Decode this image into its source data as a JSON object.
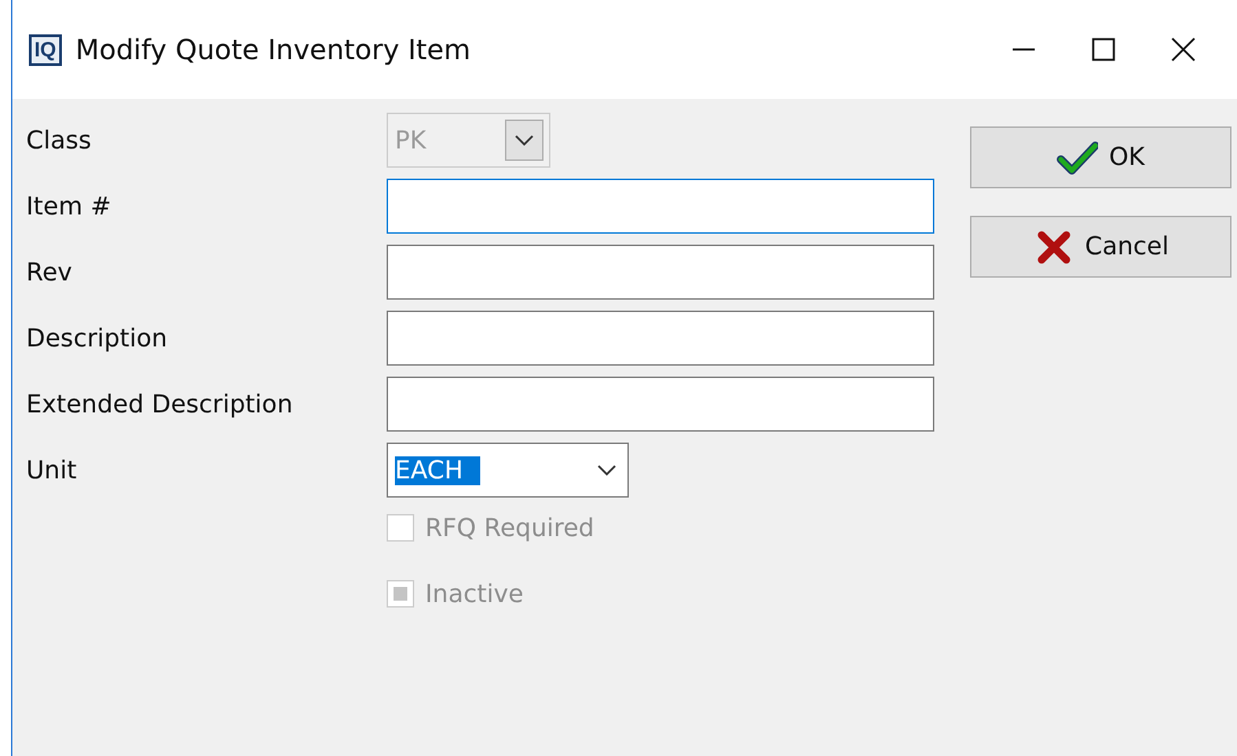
{
  "window": {
    "title": "Modify Quote Inventory Item",
    "app_icon": "IQ"
  },
  "fields": [
    {
      "kind": "combo",
      "label": "Class",
      "value": "PK",
      "disabled": true
    },
    {
      "kind": "text",
      "label": "Item #",
      "focused": true
    },
    {
      "kind": "text",
      "label": "Rev",
      "focused": false
    },
    {
      "kind": "text",
      "label": "Description",
      "focused": false
    },
    {
      "kind": "text",
      "label": "Extended Description",
      "focused": false
    },
    {
      "kind": "combo",
      "label": "Unit",
      "value": "EACH",
      "disabled": false
    }
  ],
  "checkboxes": [
    {
      "label": "RFQ Required",
      "checked": false,
      "indeterminate": false,
      "disabled": true
    },
    {
      "label": "Inactive",
      "checked": false,
      "indeterminate": true,
      "disabled": true
    }
  ],
  "buttons": [
    {
      "kind": "ok",
      "label": "OK"
    },
    {
      "kind": "cancel",
      "label": "Cancel"
    }
  ]
}
